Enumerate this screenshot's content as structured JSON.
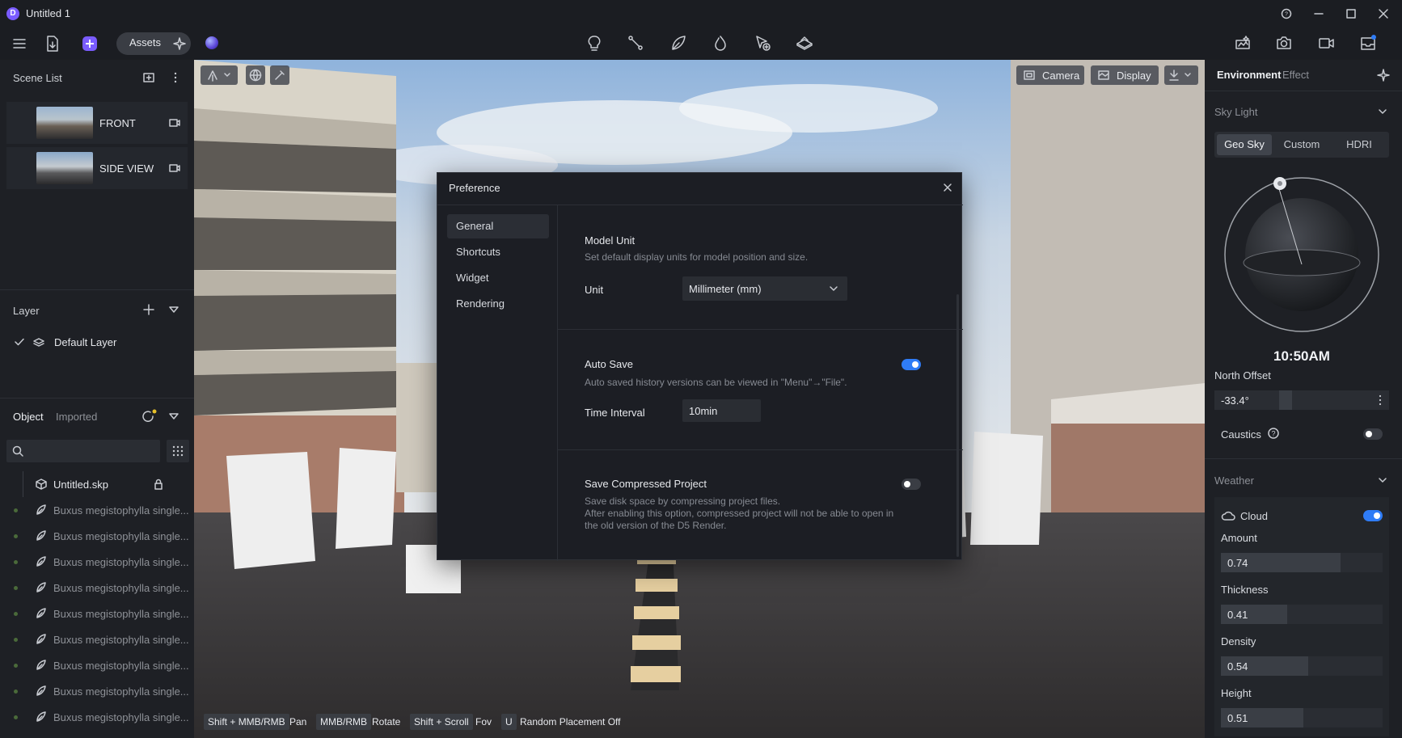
{
  "app": {
    "title": "Untitled 1",
    "logo_letter": "D"
  },
  "toolbar": {
    "assets_label": "Assets"
  },
  "scene_list": {
    "title": "Scene List",
    "scenes": [
      {
        "name": "FRONT"
      },
      {
        "name": "SIDE VIEW"
      }
    ]
  },
  "layer": {
    "title": "Layer",
    "items": [
      {
        "name": "Default Layer"
      }
    ]
  },
  "objects": {
    "tabs": [
      "Object",
      "Imported"
    ],
    "root": "Untitled.skp",
    "items": [
      "Buxus megistophylla single...",
      "Buxus megistophylla single...",
      "Buxus megistophylla single...",
      "Buxus megistophylla single...",
      "Buxus megistophylla single...",
      "Buxus megistophylla single...",
      "Buxus megistophylla single...",
      "Buxus megistophylla single...",
      "Buxus megistophylla single..."
    ]
  },
  "viewport": {
    "camera_label": "Camera",
    "display_label": "Display",
    "hints": [
      {
        "key": "Shift + MMB/RMB",
        "action": "Pan"
      },
      {
        "key": "MMB/RMB",
        "action": "Rotate"
      },
      {
        "key": "Shift + Scroll",
        "action": "Fov"
      },
      {
        "key": "U",
        "action": "Random Placement Off"
      }
    ]
  },
  "preference": {
    "title": "Preference",
    "nav": [
      "General",
      "Shortcuts",
      "Widget",
      "Rendering"
    ],
    "active_nav": 0,
    "model_unit": {
      "title": "Model Unit",
      "desc": "Set default display units for model position and size.",
      "unit_label": "Unit",
      "unit_value": "Millimeter (mm)"
    },
    "auto_save": {
      "title": "Auto Save",
      "enabled": true,
      "desc": "Auto saved history versions can be viewed in \"Menu\"→\"File\".",
      "interval_label": "Time Interval",
      "interval_value": "10min"
    },
    "compressed": {
      "title": "Save Compressed Project",
      "enabled": false,
      "desc1": "Save disk space by compressing project files.",
      "desc2": "After enabling this option, compressed project will not be able to open in",
      "desc3": "the old version of the D5 Render."
    }
  },
  "environment": {
    "tabs": [
      "Environment",
      "Effect"
    ],
    "sky_light": {
      "title": "Sky Light",
      "modes": [
        "Geo Sky",
        "Custom",
        "HDRI"
      ],
      "active_mode": 0,
      "time": "10:50AM",
      "north_offset_label": "North Offset",
      "north_offset_value": "-33.4°",
      "caustics_label": "Caustics",
      "caustics_enabled": false
    },
    "weather": {
      "title": "Weather",
      "cloud_label": "Cloud",
      "cloud_enabled": true,
      "params": [
        {
          "label": "Amount",
          "value": "0.74",
          "fraction": 0.74
        },
        {
          "label": "Thickness",
          "value": "0.41",
          "fraction": 0.41
        },
        {
          "label": "Density",
          "value": "0.54",
          "fraction": 0.54
        },
        {
          "label": "Height",
          "value": "0.51",
          "fraction": 0.51
        }
      ]
    }
  },
  "colors": {
    "accent": "#2f7cf6",
    "panel": "#1e2025",
    "dialog": "#1c1e24"
  }
}
